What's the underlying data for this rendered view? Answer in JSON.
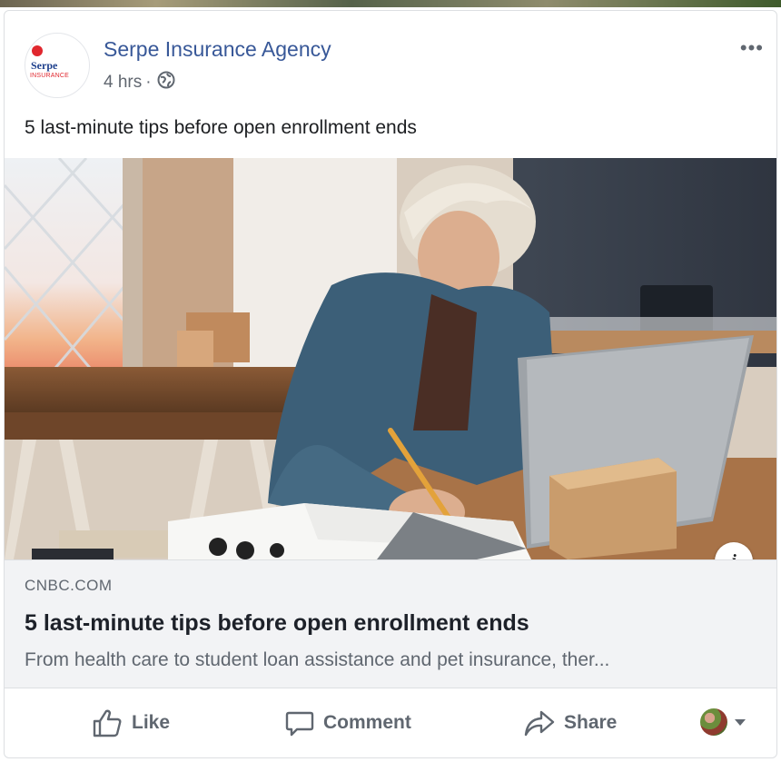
{
  "post": {
    "page_name": "Serpe Insurance Agency",
    "timestamp": "4 hrs",
    "separator": "·",
    "privacy_icon": "globe-icon",
    "more_label": "•••",
    "text": "5 last-minute tips before open enrollment ends"
  },
  "avatar": {
    "logo_word": "Serpe",
    "logo_sub": "INSURANCE"
  },
  "link": {
    "domain": "CNBC.COM",
    "title": "5 last-minute tips before open enrollment ends",
    "description": "From health care to student loan assistance and pet insurance, ther...",
    "info_label": "i"
  },
  "actions": {
    "like": "Like",
    "comment": "Comment",
    "share": "Share"
  },
  "colors": {
    "page_name": "#385898",
    "meta": "#616770",
    "link_bg": "#f2f3f5"
  }
}
